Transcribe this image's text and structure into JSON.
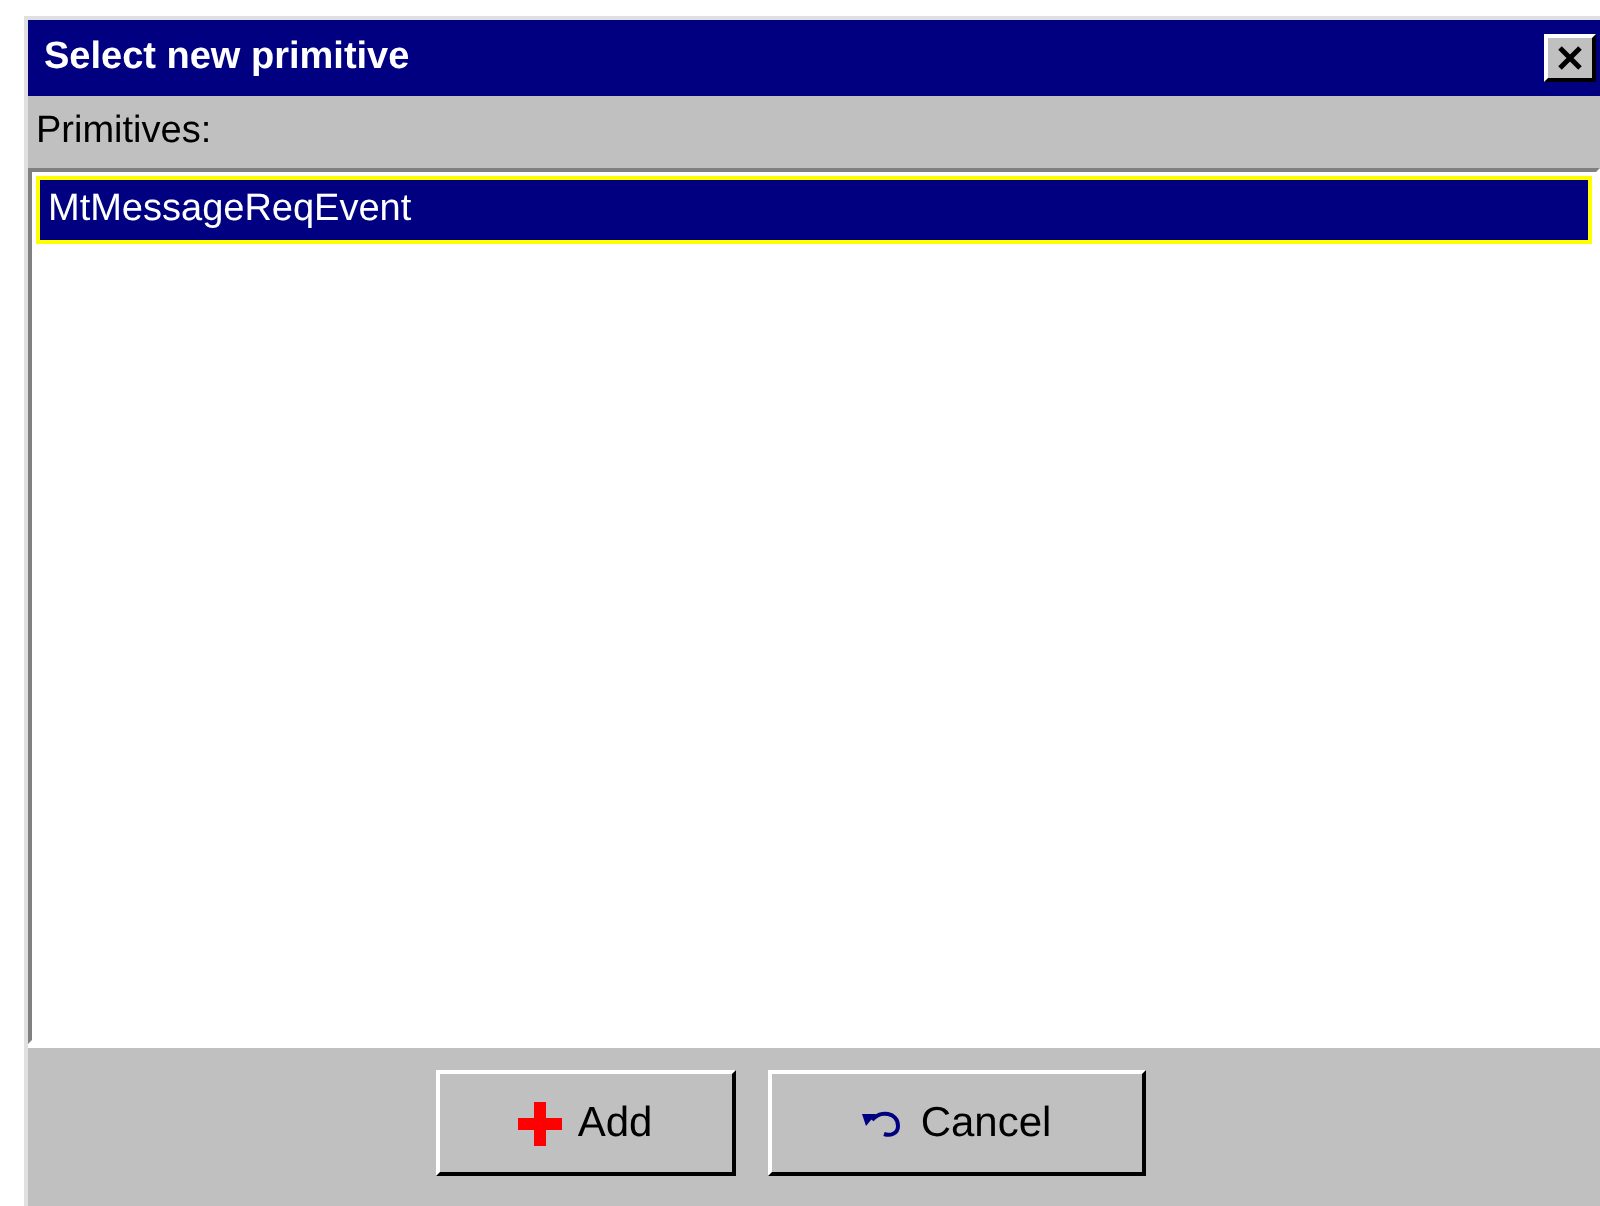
{
  "window": {
    "title": "Select new primitive"
  },
  "list_label": "Primitives:",
  "primitives": [
    {
      "label": "MtMessageReqEvent",
      "selected": true
    }
  ],
  "buttons": [
    {
      "kind": "add",
      "label": "Add"
    },
    {
      "kind": "cancel",
      "label": "Cancel"
    }
  ]
}
